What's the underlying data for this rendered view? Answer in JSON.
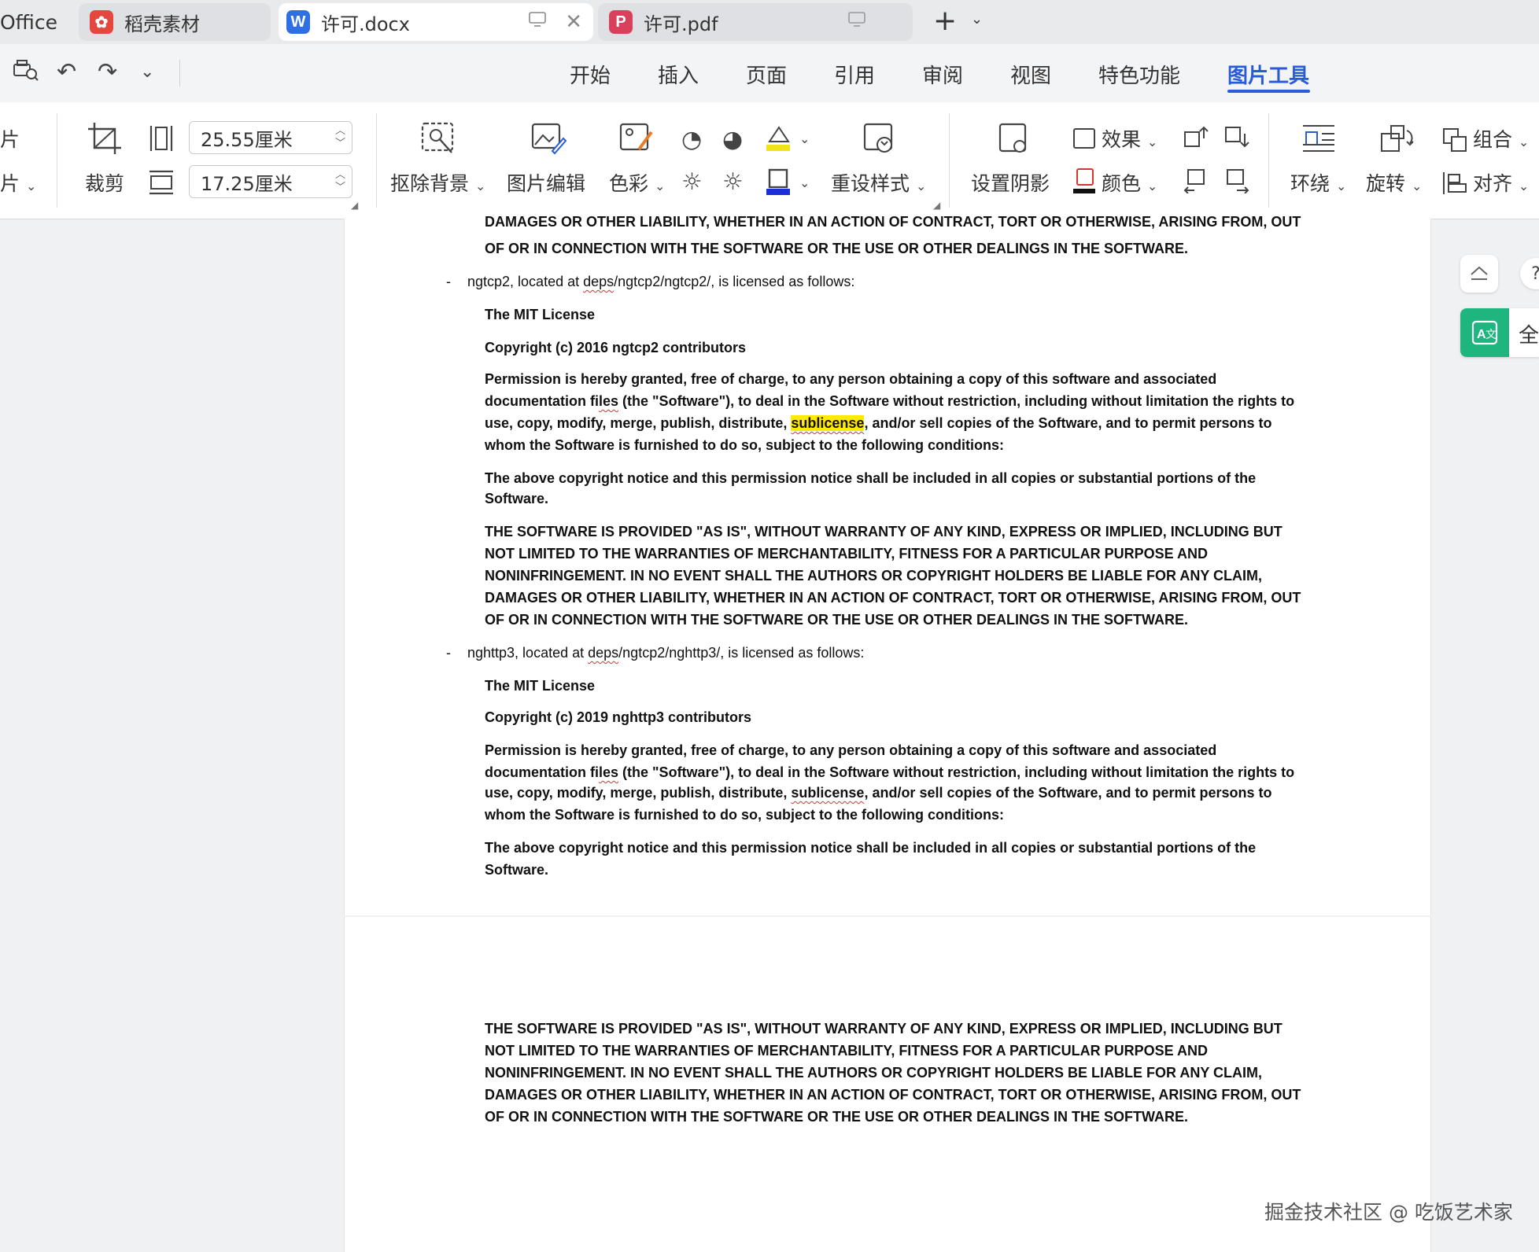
{
  "tabs": [
    {
      "label": "Office"
    },
    {
      "label": "稻壳素材"
    },
    {
      "label": "许可.docx"
    },
    {
      "label": "许可.pdf"
    }
  ],
  "menu": [
    "开始",
    "插入",
    "页面",
    "引用",
    "审阅",
    "视图",
    "特色功能",
    "图片工具"
  ],
  "menu_active": "图片工具",
  "ribbon": {
    "left_partial_1": "片",
    "left_partial_2": "片",
    "crop": "裁剪",
    "width_value": "25.55厘米",
    "height_value": "17.25厘米",
    "remove_bg": "抠除背景",
    "picture_edit": "图片编辑",
    "color_tone": "色彩",
    "reset_style": "重设样式",
    "set_shadow": "设置阴影",
    "effect": "效果",
    "color": "颜色",
    "wrap": "环绕",
    "rotate": "旋转",
    "group": "组合",
    "align": "对齐"
  },
  "doc": {
    "top_line1": "DAMAGES OR OTHER LIABILITY, WHETHER IN AN ACTION OF CONTRACT, TORT OR OTHERWISE, ARISING FROM, OUT",
    "top_line2": "OF OR IN CONNECTION WITH THE SOFTWARE OR THE USE OR OTHER DEALINGS IN THE SOFTWARE.",
    "bullet1_pre": "ngtcp2, located at ",
    "bullet1_path_a": "deps",
    "bullet1_post": "/ngtcp2/ngtcp2/, is licensed as follows:",
    "mit": "The MIT License",
    "copy1": "Copyright (c) 2016 ngtcp2 contributors",
    "perm_l1": "Permission is hereby granted, free of charge, to any person obtaining a copy of this software and associated",
    "perm_l2_a": "documentation fi",
    "perm_l2_b": "les",
    "perm_l2_c": " (the \"Software\"), to deal in the Software without restriction, including without limitation the rights to",
    "perm_l3_a": "use, copy, modify, merge, publish, distribute, ",
    "perm_l3_b": "sublicense",
    "perm_l3_c": ", and/or sell copies of the Software, and to permit persons to",
    "perm_l4": "whom the Software is furnished to do so, subject to the following conditions:",
    "notice_l1": "The above copyright notice and this permission notice shall be included in all copies or substantial portions of the",
    "notice_l2": "Software.",
    "asis_l1": "THE SOFTWARE IS PROVIDED \"AS IS\", WITHOUT WARRANTY OF ANY KIND, EXPRESS OR IMPLIED, INCLUDING BUT",
    "asis_l2": "NOT LIMITED TO THE WARRANTIES OF MERCHANTABILITY, FITNESS FOR A PARTICULAR PURPOSE AND",
    "asis_l3": "NONINFRINGEMENT. IN NO EVENT SHALL THE AUTHORS OR COPYRIGHT HOLDERS BE LIABLE FOR ANY CLAIM,",
    "asis_l4": "DAMAGES OR OTHER LIABILITY, WHETHER IN AN ACTION OF CONTRACT, TORT OR OTHERWISE, ARISING FROM, OUT",
    "asis_l5": "OF OR IN CONNECTION WITH THE SOFTWARE OR THE USE OR OTHER DEALINGS IN THE SOFTWARE.",
    "bullet2_pre": "nghttp3, located at ",
    "bullet2_path_a": "deps",
    "bullet2_post": "/ngtcp2/nghttp3/, is licensed as follows:",
    "copy2": "Copyright (c) 2019 nghttp3 contributors",
    "dash": "-"
  },
  "side": {
    "translate_label": "全",
    "help": "?"
  },
  "watermark": "掘金技术社区 @ 吃饭艺术家",
  "colors": {
    "accent": "#2a5bd7",
    "highlight": "#ffeb00",
    "translate_green": "#1fb57f"
  }
}
